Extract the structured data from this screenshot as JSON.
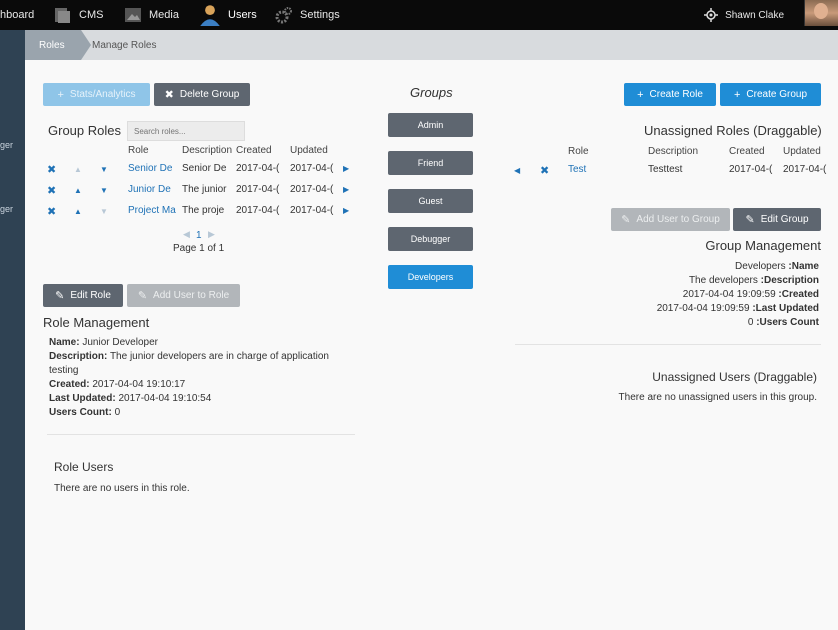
{
  "topnav": {
    "items": [
      {
        "label": "hboard",
        "icon": "dashboard-icon"
      },
      {
        "label": "CMS",
        "icon": "cms-icon"
      },
      {
        "label": "Media",
        "icon": "media-icon"
      },
      {
        "label": "Users",
        "icon": "user-icon"
      },
      {
        "label": "Settings",
        "icon": "gear-icon"
      }
    ],
    "user_name": "Shawn Clake"
  },
  "sidebar": {
    "labels": [
      "ger",
      "ger"
    ]
  },
  "breadcrumb": {
    "active": "Roles",
    "current": "Manage Roles"
  },
  "left": {
    "stats_label": "Stats/Analytics",
    "delete_group_label": "Delete Group",
    "group_roles_title": "Group Roles",
    "search_placeholder": "Search roles...",
    "columns": [
      "Role",
      "Description",
      "Created",
      "Updated"
    ],
    "rows": [
      {
        "role": "Senior De",
        "description": "Senior De",
        "created": "2017-04-(",
        "updated": "2017-04-("
      },
      {
        "role": "Junior De",
        "description": "The junior",
        "created": "2017-04-(",
        "updated": "2017-04-("
      },
      {
        "role": "Project Ma",
        "description": "The proje",
        "created": "2017-04-(",
        "updated": "2017-04-("
      }
    ],
    "page_number": "1",
    "page_text": "Page 1 of 1",
    "edit_role_label": "Edit Role",
    "add_user_label": "Add User to Role",
    "role_mgmt_title": "Role Management",
    "role_info": {
      "name_label": "Name:",
      "name": "Junior Developer",
      "desc_label": "Description:",
      "desc_1": "The junior developers are in charge of application",
      "desc_2": "testing",
      "created_label": "Created:",
      "created": "2017-04-04 19:10:17",
      "updated_label": "Last Updated:",
      "updated": "2017-04-04 19:10:54",
      "count_label": "Users Count:",
      "count": "0"
    },
    "role_users_title": "Role Users",
    "role_users_empty": "There are no users in this role."
  },
  "groups": {
    "title": "Groups",
    "items": [
      "Admin",
      "Friend",
      "Guest",
      "Debugger",
      "Developers"
    ],
    "active_index": 4
  },
  "right": {
    "create_role_label": "Create Role",
    "create_group_label": "Create Group",
    "unassigned_roles_title": "Unassigned Roles (Draggable)",
    "columns": [
      "Role",
      "Description",
      "Created",
      "Updated"
    ],
    "rows": [
      {
        "role": "Test",
        "description": "Testtest",
        "created": "2017-04-(",
        "updated": "2017-04-("
      }
    ],
    "add_user_group_label": "Add User to Group",
    "edit_group_label": "Edit Group",
    "group_mgmt_title": "Group Management",
    "group_info": {
      "name": "Developers",
      "name_label": ":Name",
      "desc": "The developers",
      "desc_label": ":Description",
      "created": "2017-04-04 19:09:59",
      "created_label": ":Created",
      "updated": "2017-04-04 19:09:59",
      "updated_label": ":Last Updated",
      "count": "0",
      "count_label": ":Users Count"
    },
    "unassigned_users_title": "Unassigned Users (Draggable)",
    "unassigned_users_empty": "There are no unassigned users in this group."
  }
}
